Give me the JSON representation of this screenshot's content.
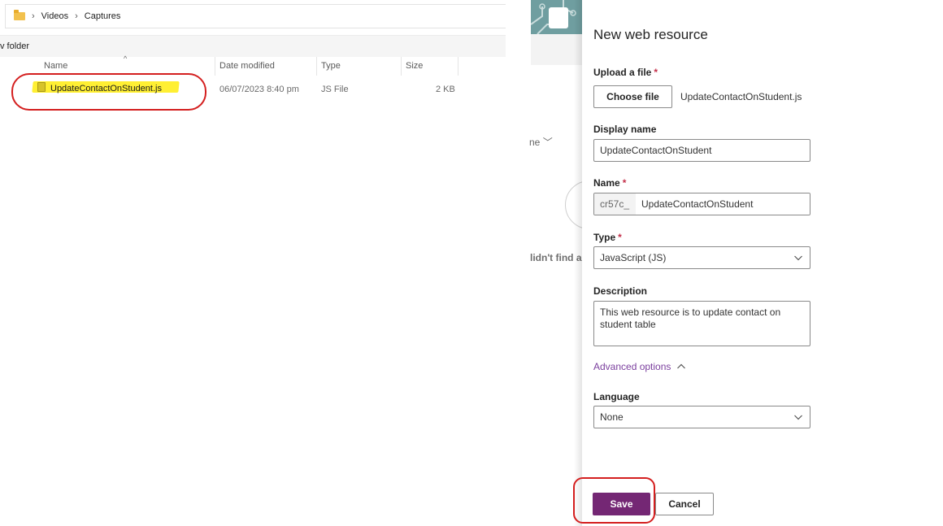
{
  "explorer": {
    "breadcrumb": [
      "Videos",
      "Captures"
    ],
    "command_fragment": "v folder",
    "columns": {
      "name": "Name",
      "date_modified": "Date modified",
      "type": "Type",
      "size": "Size"
    },
    "file": {
      "name": "UpdateContactOnStudent.js",
      "date_modified": "06/07/2023 8:40 pm",
      "type": "JS File",
      "size": "2 KB"
    }
  },
  "background": {
    "filter_fragment": "ne",
    "message_fragment": "lidn't find a"
  },
  "panel": {
    "title": "New web resource",
    "upload": {
      "label": "Upload a file",
      "required": "*",
      "button": "Choose file",
      "filename": "UpdateContactOnStudent.js"
    },
    "display_name": {
      "label": "Display name",
      "value": "UpdateContactOnStudent"
    },
    "name": {
      "label": "Name",
      "required": "*",
      "prefix": "cr57c_",
      "value": "UpdateContactOnStudent"
    },
    "type": {
      "label": "Type",
      "required": "*",
      "value": "JavaScript (JS)"
    },
    "description": {
      "label": "Description",
      "value": "This web resource is to update contact on student table"
    },
    "advanced_options": "Advanced options",
    "language": {
      "label": "Language",
      "value": "None"
    },
    "save": "Save",
    "cancel": "Cancel"
  },
  "colors": {
    "accent": "#742774",
    "link": "#7b3f9e",
    "annotation": "#d41f1f",
    "highlight": "#ffef33"
  }
}
